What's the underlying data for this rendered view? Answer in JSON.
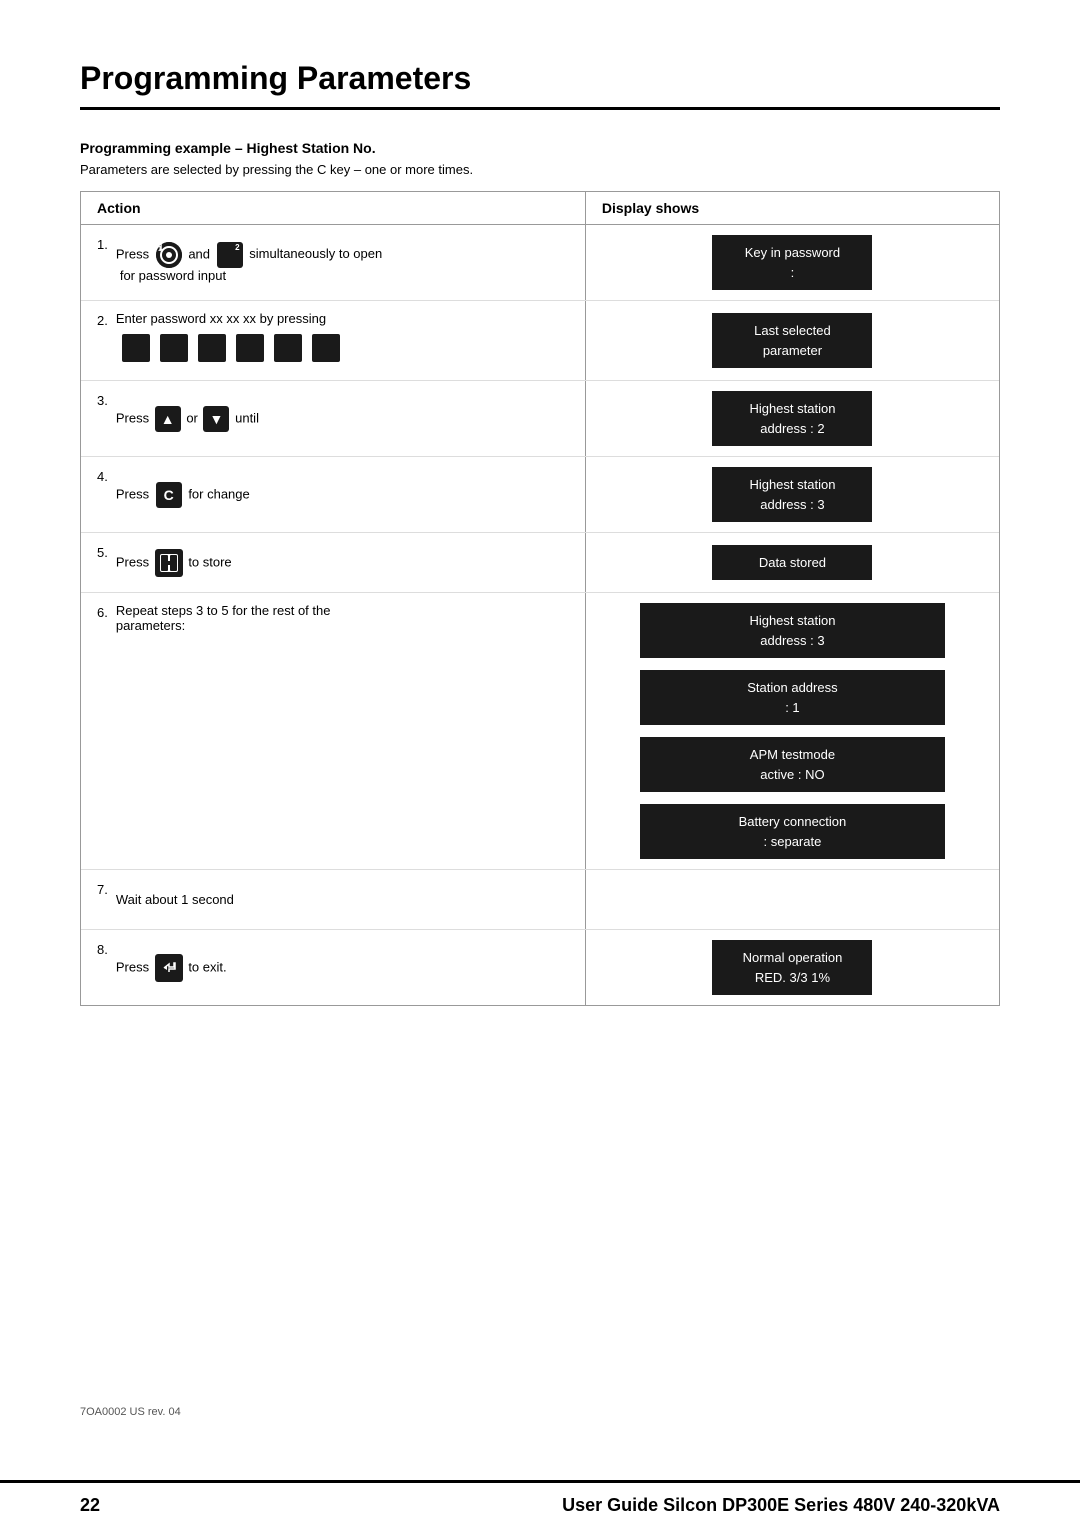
{
  "page": {
    "title": "Programming Parameters",
    "doc_ref": "7OA0002 US rev. 04",
    "footer_page": "22",
    "footer_title": "User Guide Silcon DP300E Series 480V 240-320kVA"
  },
  "section": {
    "heading": "Programming example – Highest Station No.",
    "subtext": "Parameters are selected by pressing the C key – one or more times.",
    "table": {
      "col_action": "Action",
      "col_display": "Display shows",
      "rows": [
        {
          "step": "1.",
          "action_text": "simultaneously to open for password input",
          "display": "Key in password\n:"
        },
        {
          "step": "2.",
          "action_text": "Enter password xx xx xx by pressing",
          "display": "Last selected\nparameter"
        },
        {
          "step": "3.",
          "action_text": "or",
          "action_suffix": "until",
          "display": "Highest station\naddress  :  2"
        },
        {
          "step": "4.",
          "action_text": "for change",
          "display": "Highest station\naddress  :  3"
        },
        {
          "step": "5.",
          "action_text": "to store",
          "display": "Data stored"
        },
        {
          "step": "6.",
          "action_text": "Repeat steps 3 to 5 for the rest of the parameters:",
          "displays": [
            "Highest station\naddress  :  3",
            "Station address\n:  1",
            "APM testmode\nactive  :  NO",
            "Battery connection\n:  separate"
          ]
        },
        {
          "step": "7.",
          "action_text": "Wait about 1 second",
          "display": ""
        },
        {
          "step": "8.",
          "action_text": "to exit.",
          "display": "Normal operation\nRED.  3/3  1%"
        }
      ]
    }
  }
}
